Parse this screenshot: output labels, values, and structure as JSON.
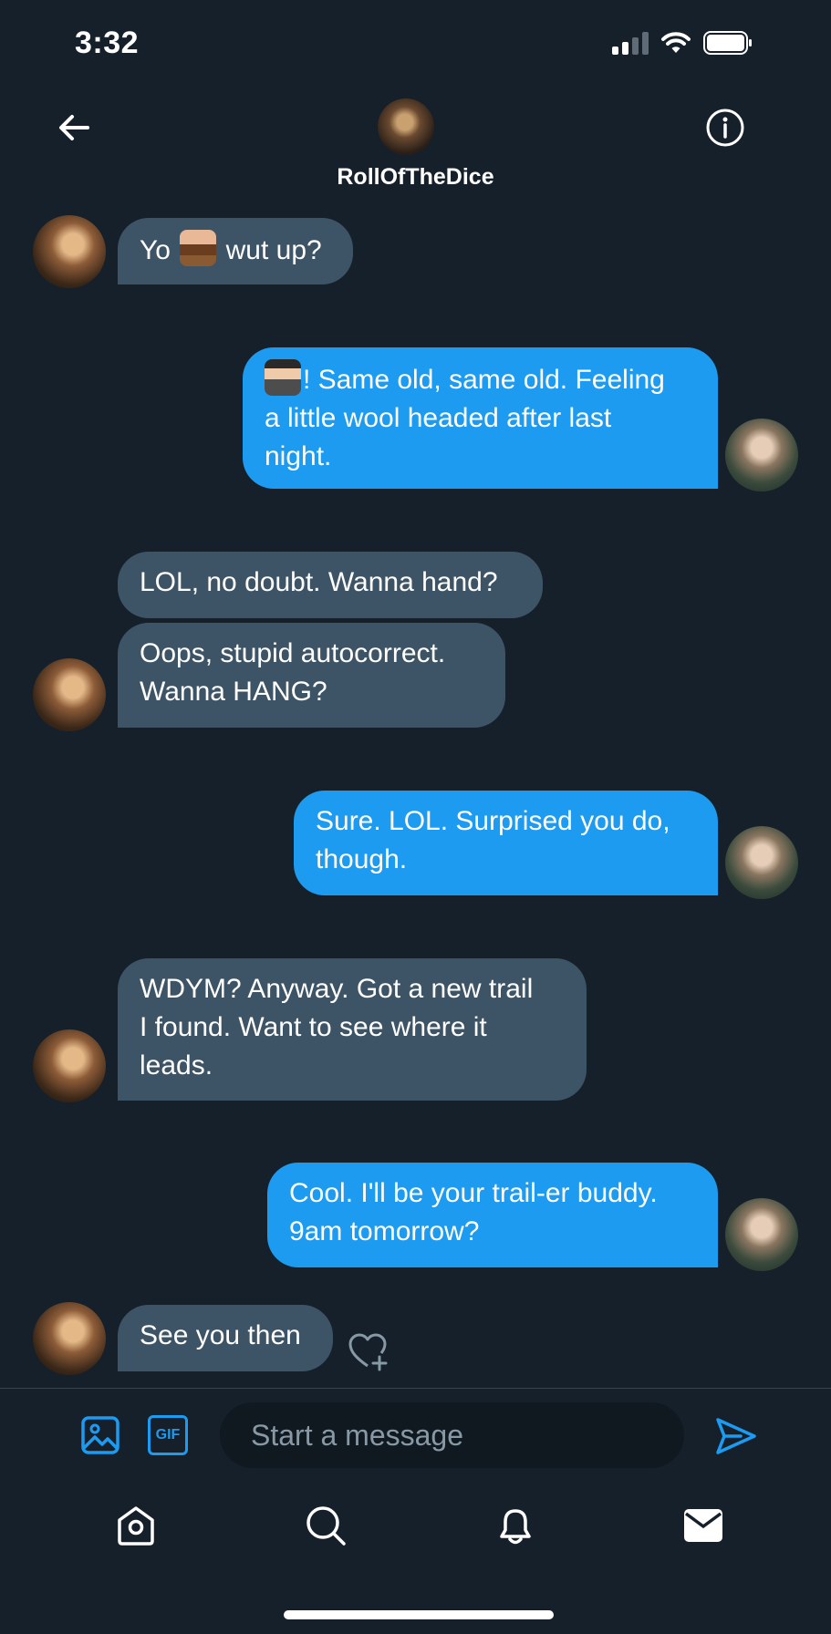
{
  "status_bar": {
    "time": "3:32",
    "icons": [
      "cellular-signal-icon",
      "wifi-icon",
      "battery-icon"
    ]
  },
  "header": {
    "back_icon": "back-arrow-icon",
    "info_icon": "info-icon",
    "contact_name": "RollOfTheDice"
  },
  "messages": [
    {
      "from": "them",
      "parts": [
        "Yo ",
        " wut up?"
      ],
      "emoji": "person-hiking-emoji"
    },
    {
      "from": "me",
      "lines": [
        "! Same old, same old. Feeling",
        "a little wool headed after last",
        "night."
      ],
      "emoji": "man-technologist-emoji"
    },
    {
      "from": "them",
      "text": "LOL, no doubt. Wanna hand?"
    },
    {
      "from": "them",
      "lines": [
        "Oops, stupid autocorrect.",
        "Wanna HANG?"
      ]
    },
    {
      "from": "me",
      "lines": [
        "Sure. LOL. Surprised you do,",
        "though."
      ]
    },
    {
      "from": "them",
      "lines": [
        "WDYM? Anyway. Got a new trail",
        "I found. Want to see where it",
        "leads."
      ]
    },
    {
      "from": "me",
      "lines": [
        "Cool. I'll be your trail-er buddy.",
        "9am tomorrow?"
      ]
    },
    {
      "from": "them",
      "text": "See you then"
    }
  ],
  "composer": {
    "placeholder": "Start a message",
    "image_icon": "image-icon",
    "gif_label": "GIF",
    "send_icon": "send-icon"
  },
  "bottom_nav": [
    "home-icon",
    "search-icon",
    "bell-icon",
    "mail-icon"
  ],
  "colors": {
    "background": "#15202b",
    "outgoing_bubble": "#1d9bf0",
    "incoming_bubble": "#3d5466",
    "accent": "#1d9bf0"
  }
}
